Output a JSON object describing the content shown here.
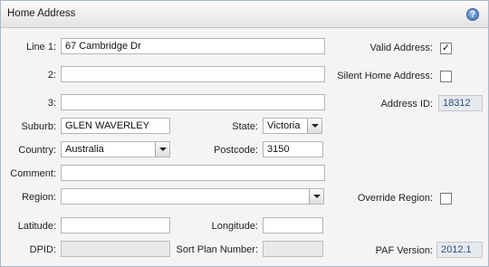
{
  "header": {
    "title": "Home Address",
    "help_icon": "?"
  },
  "labels": {
    "line1": "Line 1:",
    "line2": "2:",
    "line3": "3:",
    "suburb": "Suburb:",
    "state": "State:",
    "country": "Country:",
    "postcode": "Postcode:",
    "comment": "Comment:",
    "region": "Region:",
    "latitude": "Latitude:",
    "longitude": "Longitude:",
    "dpid": "DPID:",
    "sort_plan": "Sort Plan Number:",
    "valid_address": "Valid Address:",
    "silent_home": "Silent Home Address:",
    "address_id": "Address ID:",
    "override_region": "Override Region:",
    "paf_version": "PAF Version:"
  },
  "values": {
    "line1": "67 Cambridge Dr",
    "line2": "",
    "line3": "",
    "suburb": "GLEN WAVERLEY",
    "state": "Victoria",
    "country": "Australia",
    "postcode": "3150",
    "comment": "",
    "region": "",
    "latitude": "",
    "longitude": "",
    "dpid": "",
    "sort_plan": "",
    "address_id": "18312",
    "paf_version": "2012.1",
    "valid_address_check": "✓",
    "silent_home_check": "",
    "override_region_check": ""
  }
}
